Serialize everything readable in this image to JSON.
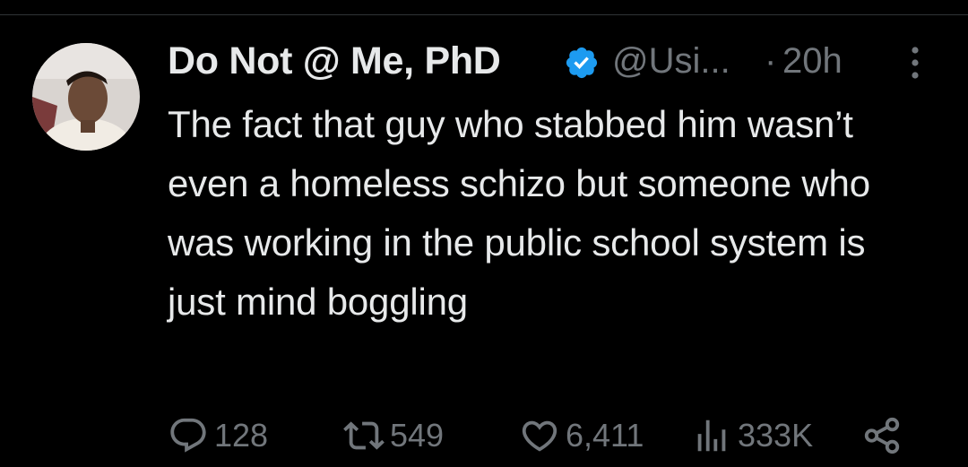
{
  "tweet": {
    "author": {
      "display_name": "Do Not @ Me, PhD",
      "handle": "@Usi...",
      "verified": true
    },
    "separator": "·",
    "timestamp": "20h",
    "text": "The fact that guy who stabbed him wasn’t even a homeless schizo but someone who was working in the public school system is just mind boggling",
    "stats": {
      "replies": "128",
      "reposts": "549",
      "likes": "6,411",
      "views": "333K"
    }
  },
  "icons": {
    "verified": "verified-badge-icon",
    "more": "more-dots-icon",
    "reply": "reply-bubble-icon",
    "repost": "repost-arrows-icon",
    "like": "heart-icon",
    "views": "bar-chart-icon",
    "share": "share-icon"
  },
  "colors": {
    "background": "#000000",
    "text_primary": "#e7e9ea",
    "text_secondary": "#71767b",
    "verified_blue": "#1d9bf0",
    "divider": "#2f3336"
  }
}
